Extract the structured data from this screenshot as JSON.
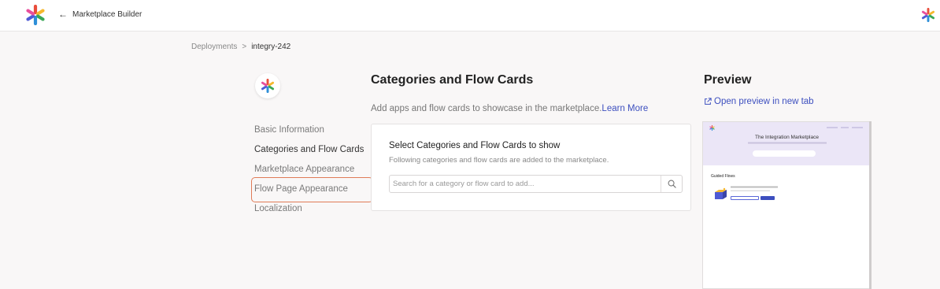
{
  "topbar": {
    "back_label": "Marketplace Builder"
  },
  "breadcrumb": {
    "parent": "Deployments",
    "separator": ">",
    "current": "integry-242"
  },
  "sidenav": {
    "items": [
      {
        "label": "Basic Information"
      },
      {
        "label": "Categories and Flow Cards"
      },
      {
        "label": "Marketplace Appearance"
      },
      {
        "label": "Flow Page Appearance"
      },
      {
        "label": "Localization"
      }
    ],
    "active_index": 1
  },
  "main": {
    "title": "Categories and Flow Cards",
    "description": "Add apps and flow cards to showcase in the marketplace.",
    "learn_more": "Learn More",
    "card": {
      "title": "Select Categories and Flow Cards to show",
      "subtitle": "Following categories and flow cards are added to the marketplace.",
      "search_placeholder": "Search for a category or flow card to add...",
      "search_value": ""
    }
  },
  "preview": {
    "title": "Preview",
    "open_link": "Open preview in new tab",
    "frame": {
      "hero_title": "The Integration Marketplace",
      "section_title": "Guided Flows"
    }
  },
  "colors": {
    "accent": "#3d4fbf",
    "highlight_border": "#e07b57",
    "page_bg": "#f9f7f7",
    "preview_hero_bg": "#ebe6f7"
  },
  "icons": {
    "logo": "asterisk-logo-icon",
    "back": "arrow-left-icon",
    "search": "search-icon",
    "external": "external-link-icon"
  }
}
